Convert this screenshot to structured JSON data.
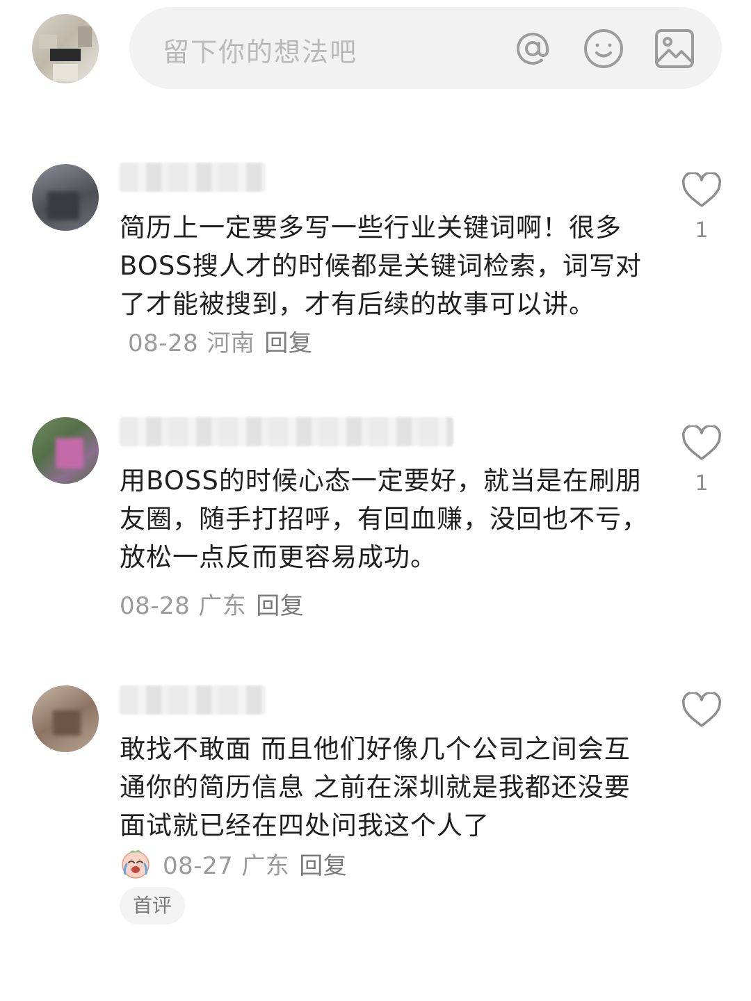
{
  "composer": {
    "placeholder": "留下你的想法吧",
    "icons": [
      "at-icon",
      "emoji-icon",
      "image-icon"
    ]
  },
  "comments": [
    {
      "text": "简历上一定要多写一些行业关键词啊！很多BOSS搜人才的时候都是关键词检索，词写对了才能被搜到，才有后续的故事可以讲。",
      "date": "08-28",
      "location": "河南",
      "reply": "回复",
      "likes": "1"
    },
    {
      "text": "用BOSS的时候心态一定要好，就当是在刷朋友圈，随手打招呼，有回血赚，没回也不亏，放松一点反而更容易成功。",
      "date": "08-28",
      "location": "广东",
      "reply": "回复",
      "likes": "1"
    },
    {
      "text": "敢找不敢面 而且他们好像几个公司之间会互通你的简历信息 之前在深圳就是我都还没要面试就已经在四处问我这个人了",
      "date": "08-27",
      "location": "广东",
      "reply": "回复",
      "likes": "",
      "badge": "首评"
    }
  ],
  "colors": {
    "text": "#1f1f1f",
    "meta": "#9a9a9a",
    "input_bg": "#f2f2f2",
    "icon": "#9c9c9c"
  }
}
